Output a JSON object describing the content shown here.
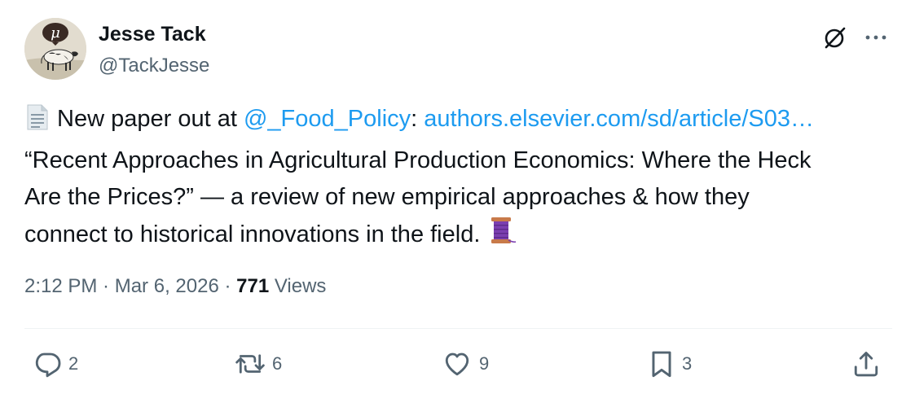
{
  "author": {
    "name": "Jesse Tack",
    "handle": "@TackJesse",
    "avatar_letter": "μ"
  },
  "header_icons": [
    "grok-icon",
    "more-icon"
  ],
  "tweet": {
    "line1": {
      "emoji": "page-facing-up-emoji",
      "text_before": " New paper out at ",
      "mention": "@_Food_Policy",
      "text_mid": ": ",
      "link": "authors.elsevier.com/sd/article/S03…"
    },
    "line2": "“Recent Approaches in Agricultural Production Economics: Where the Heck",
    "line3": "Are the Prices?” — a review of new empirical approaches & how they",
    "line4": {
      "text": "connect to historical innovations in the field. ",
      "emoji": "thread-spool-emoji"
    }
  },
  "meta": {
    "time": "2:12 PM",
    "sep1": " · ",
    "date": "Mar 6, 2026",
    "sep2": " · ",
    "views_count": "771",
    "views_label": " Views"
  },
  "actions": {
    "reply": {
      "icon": "reply-icon",
      "count": "2"
    },
    "retweet": {
      "icon": "retweet-icon",
      "count": "6"
    },
    "like": {
      "icon": "heart-icon",
      "count": "9"
    },
    "bookmark": {
      "icon": "bookmark-icon",
      "count": "3"
    },
    "share": {
      "icon": "share-icon"
    }
  },
  "colors": {
    "link": "#1d9bf0",
    "text": "#0f1419",
    "secondary": "#536471",
    "divider": "#eff3f4"
  }
}
